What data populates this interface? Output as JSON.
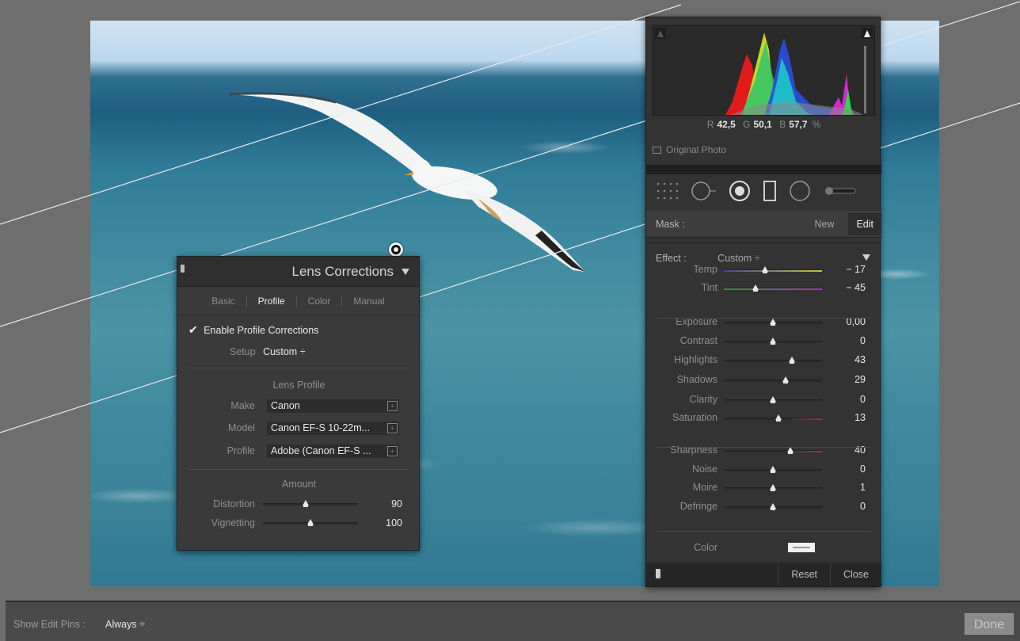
{
  "lens_panel": {
    "title": "Lens Corrections",
    "tabs": [
      "Basic",
      "Profile",
      "Color",
      "Manual"
    ],
    "active_tab": "Profile",
    "enable_label": "Enable Profile Corrections",
    "setup": {
      "label": "Setup",
      "value": "Custom ÷"
    },
    "lens_profile_heading": "Lens Profile",
    "make": {
      "label": "Make",
      "value": "Canon"
    },
    "model": {
      "label": "Model",
      "value": "Canon EF-S 10-22m..."
    },
    "profile": {
      "label": "Profile",
      "value": "Adobe (Canon EF-S ..."
    },
    "amount_heading": "Amount",
    "distortion": {
      "label": "Distortion",
      "value": "90",
      "level": 0.45
    },
    "vignetting": {
      "label": "Vignetting",
      "value": "100",
      "level": 0.5
    }
  },
  "histogram": {
    "r_label": "R",
    "r_value": "42,5",
    "g_label": "G",
    "g_value": "50,1",
    "b_label": "B",
    "b_value": "57,7",
    "unit": "%",
    "original_photo": "Original Photo"
  },
  "mask": {
    "label": "Mask :",
    "new": "New",
    "edit": "Edit"
  },
  "effect": {
    "label": "Effect :",
    "preset": "Custom ÷",
    "rows": [
      {
        "label": "Temp",
        "value": "− 17",
        "level": 0.42,
        "track": "temp"
      },
      {
        "label": "Tint",
        "value": "− 45",
        "level": 0.32,
        "track": "tint"
      },
      {
        "label": "Exposure",
        "value": "0,00",
        "level": 0.5
      },
      {
        "label": "Contrast",
        "value": "0",
        "level": 0.5
      },
      {
        "label": "Highlights",
        "value": "43",
        "level": 0.69
      },
      {
        "label": "Shadows",
        "value": "29",
        "level": 0.63
      },
      {
        "label": "Clarity",
        "value": "0",
        "level": 0.5
      },
      {
        "label": "Saturation",
        "value": "13",
        "level": 0.56,
        "track": "sat"
      },
      {
        "label": "Sharpness",
        "value": "40",
        "level": 0.68,
        "track": "sharp"
      },
      {
        "label": "Noise",
        "value": "0",
        "level": 0.5
      },
      {
        "label": "Moire",
        "value": "1",
        "level": 0.5
      },
      {
        "label": "Defringe",
        "value": "0",
        "level": 0.5
      }
    ],
    "color_label": "Color"
  },
  "footer": {
    "reset": "Reset",
    "close": "Close"
  },
  "bottom_bar": {
    "show_edit_pins_label": "Show Edit Pins :",
    "show_edit_pins_value": "Always ÷",
    "done": "Done"
  }
}
